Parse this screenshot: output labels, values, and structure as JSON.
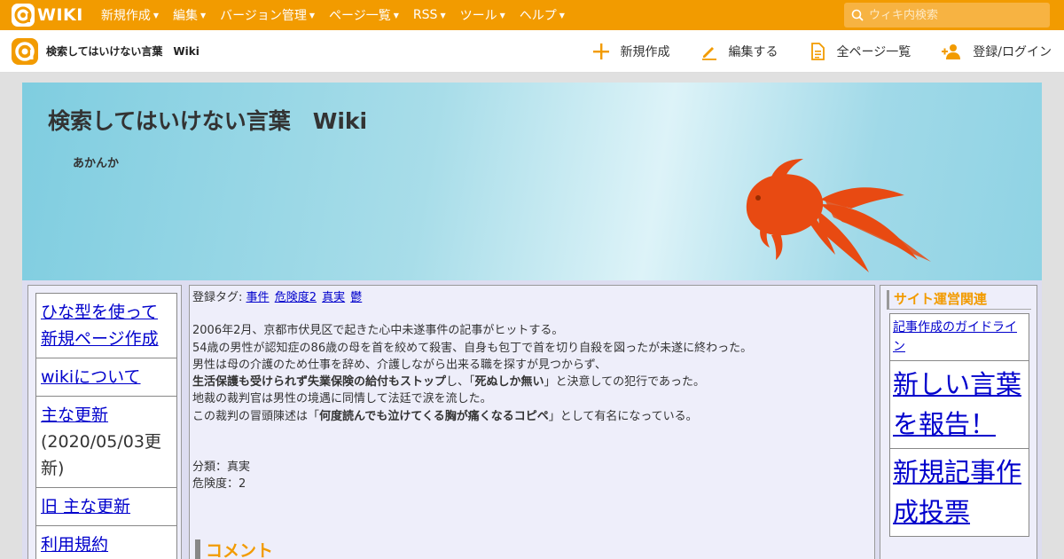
{
  "topbar": {
    "logo_text": "WIKI",
    "menu": [
      {
        "label": "新規作成"
      },
      {
        "label": "編集"
      },
      {
        "label": "バージョン管理"
      },
      {
        "label": "ページ一覧"
      },
      {
        "label": "RSS"
      },
      {
        "label": "ツール"
      },
      {
        "label": "ヘルプ"
      }
    ],
    "search_placeholder": "ウィキ内検索"
  },
  "subbar": {
    "site_title": "検索してはいけない言葉　Wiki",
    "nav": {
      "new": "新規作成",
      "edit": "編集する",
      "all_pages": "全ページ一覧",
      "login": "登録/ログイン"
    }
  },
  "banner": {
    "title": "検索してはいけない言葉　Wiki",
    "subtitle": "あかんか"
  },
  "left_menu": {
    "item1": "ひな型を使って新規ページ作成",
    "item2": "wikiについて",
    "item3": "主な更新",
    "item3_note": "(2020/05/03更新)",
    "item4": "旧 主な更新",
    "item5": "利用規約"
  },
  "main": {
    "tags_label": "登録タグ:",
    "tags": [
      "事件",
      "危険度2",
      "真実",
      "鬱"
    ],
    "para1": "2006年2月、京都市伏見区で起きた心中未遂事件の記事がヒットする。",
    "para2": "54歳の男性が認知症の86歳の母を首を絞めて殺害、自身も包丁で首を切り自殺を図ったが未遂に終わった。",
    "para3": "男性は母の介護のため仕事を辞め、介護しながら出来る職を探すが見つからず、",
    "para4_bold": "生活保護も受けられず失業保険の給付もストップ",
    "para4_mid": "し、「",
    "para4_bold2": "死ぬしか無い",
    "para4_end": "」と決意しての犯行であった。",
    "para5": "地裁の裁判官は男性の境遇に同情して法廷で涙を流した。",
    "para6_start": "この裁判の冒頭陳述は「",
    "para6_bold": "何度読んでも泣けてくる胸が痛くなるコピペ",
    "para6_end": "」として有名になっている。",
    "category": "分類：真実",
    "danger": "危険度：2",
    "comment_heading": "コメント"
  },
  "right_menu": {
    "heading": "サイト運営関連",
    "link1": "記事作成のガイドライン",
    "link2": "新しい言葉を報告！",
    "link3": "新規記事作成投票"
  },
  "colors": {
    "brand_orange": "#f29b00",
    "link_blue": "#0000cc"
  }
}
